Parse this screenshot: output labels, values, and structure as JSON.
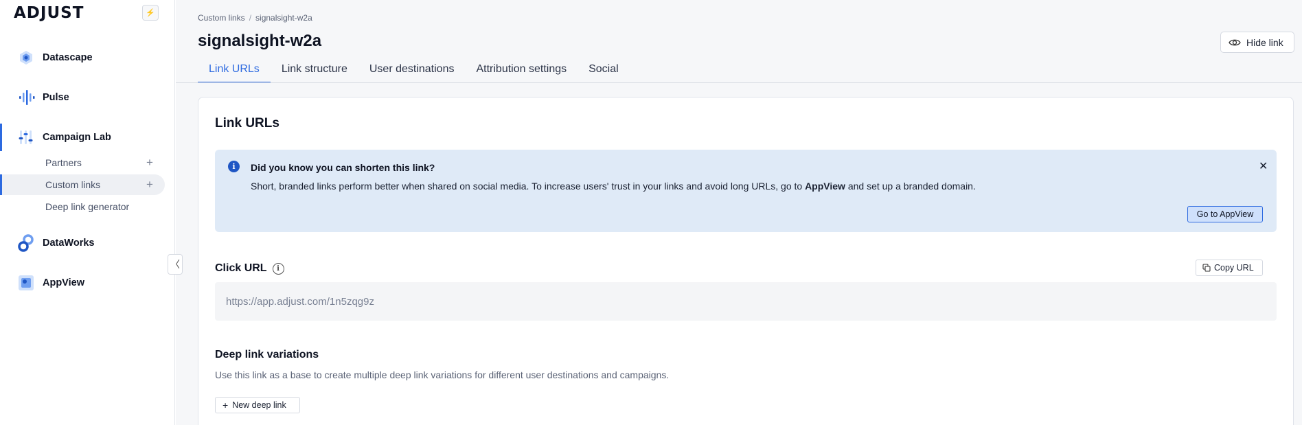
{
  "sidebar": {
    "logo": "ADJUST",
    "quick_icon": "bolt-icon",
    "items": [
      {
        "label": "Datascape",
        "icon": "datascape-icon"
      },
      {
        "label": "Pulse",
        "icon": "pulse-icon"
      },
      {
        "label": "Campaign Lab",
        "icon": "campaign-lab-icon"
      },
      {
        "label": "DataWorks",
        "icon": "dataworks-icon"
      },
      {
        "label": "AppView",
        "icon": "appview-icon"
      }
    ],
    "campaign_lab_sub": [
      {
        "label": "Partners",
        "action": "+"
      },
      {
        "label": "Custom links",
        "action": "+"
      },
      {
        "label": "Deep link generator"
      }
    ],
    "collapse_glyph": "〈"
  },
  "header": {
    "breadcrumb": [
      "Custom links",
      "signalsight-w2a"
    ],
    "breadcrumb_sep": "/",
    "title": "signalsight-w2a",
    "hide_link_label": "Hide link"
  },
  "tabs": [
    {
      "label": "Link URLs",
      "active": true
    },
    {
      "label": "Link structure",
      "active": false
    },
    {
      "label": "User destinations",
      "active": false
    },
    {
      "label": "Attribution settings",
      "active": false
    },
    {
      "label": "Social",
      "active": false
    }
  ],
  "card": {
    "title": "Link URLs",
    "banner": {
      "title": "Did you know you can shorten this link?",
      "text_before": "Short, branded links perform better when shared on social media. To increase users' trust in your links and avoid long URLs, go to ",
      "text_bold": "AppView",
      "text_after": " and set up a branded domain.",
      "button_label": "Go to AppView",
      "close_glyph": "✕"
    },
    "click_url": {
      "label": "Click URL",
      "copy_label": "Copy URL",
      "value": "https://app.adjust.com/1n5zqg9z"
    },
    "deep_links": {
      "title": "Deep link variations",
      "description": "Use this link as a base to create multiple deep link variations for different user destinations and campaigns.",
      "button_label": "New deep link"
    }
  },
  "colors": {
    "accent": "#2d6ae0",
    "banner_bg": "#dfeaf7",
    "info_icon": "#1f56c4"
  }
}
